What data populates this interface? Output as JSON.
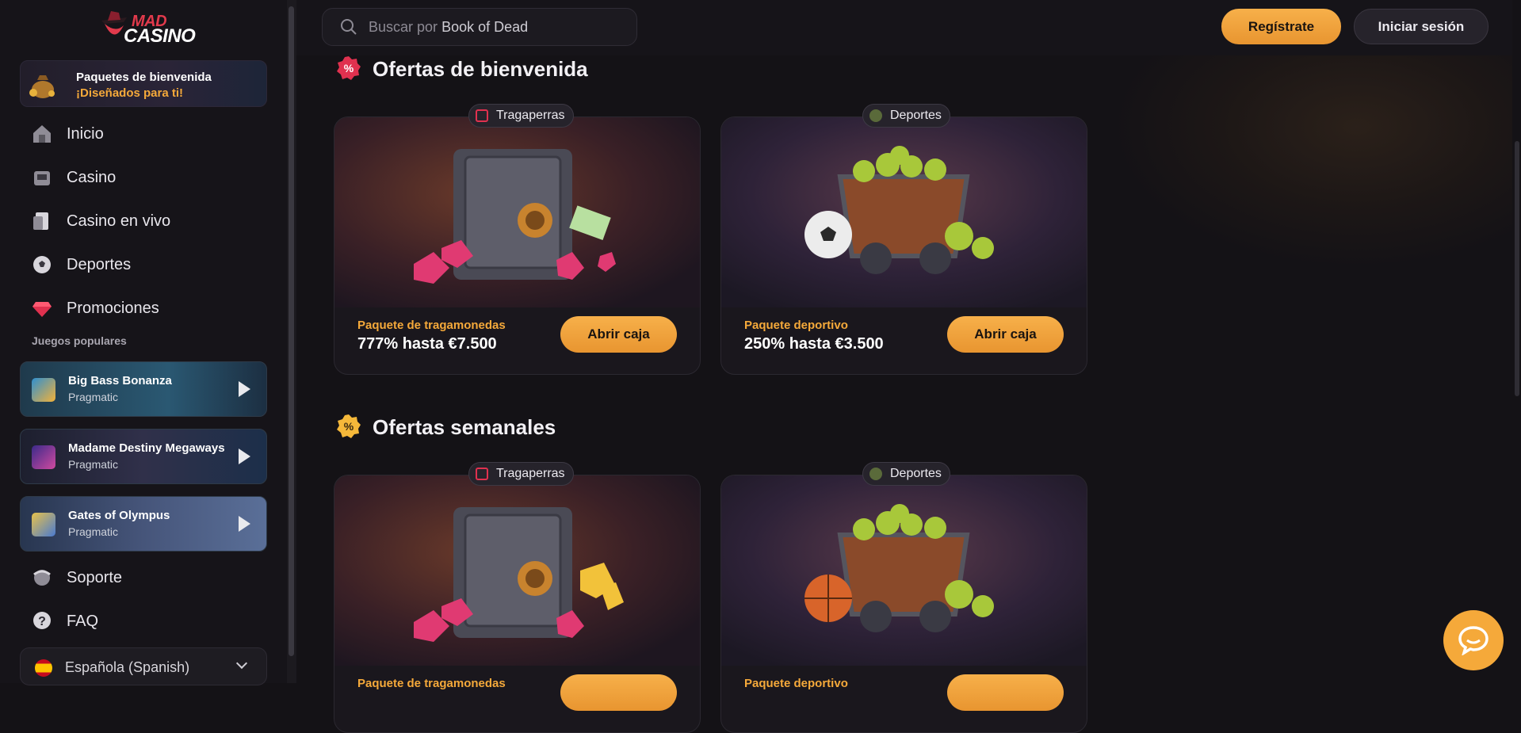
{
  "brand": {
    "logo_top": "MAD",
    "logo_bottom": "CASINO"
  },
  "sidebar": {
    "welcome": {
      "title": "Paquetes de bienvenida",
      "subtitle": "¡Diseñados para ti!"
    },
    "nav": [
      {
        "label": "Inicio",
        "icon": "home-icon"
      },
      {
        "label": "Casino",
        "icon": "casino-icon"
      },
      {
        "label": "Casino en vivo",
        "icon": "live-casino-icon"
      },
      {
        "label": "Deportes",
        "icon": "soccer-ball-icon"
      },
      {
        "label": "Promociones",
        "icon": "diamond-icon"
      }
    ],
    "popular_label": "Juegos populares",
    "games": [
      {
        "name": "Big Bass Bonanza",
        "provider": "Pragmatic"
      },
      {
        "name": "Madame Destiny Megaways",
        "provider": "Pragmatic"
      },
      {
        "name": "Gates of Olympus",
        "provider": "Pragmatic"
      }
    ],
    "bottom_nav": [
      {
        "label": "Soporte",
        "icon": "support-icon"
      },
      {
        "label": "FAQ",
        "icon": "faq-icon"
      }
    ],
    "language": "Española (Spanish)"
  },
  "header": {
    "search_prefix": "Buscar por",
    "search_example": "Book of Dead",
    "register": "Regístrate",
    "login": "Iniciar sesión"
  },
  "sections": [
    {
      "title": "Ofertas de bienvenida",
      "cards": [
        {
          "tag": "Tragaperras",
          "subtitle": "Paquete de tragamonedas",
          "value": "777% hasta €7.500",
          "button": "Abrir caja"
        },
        {
          "tag": "Deportes",
          "subtitle": "Paquete deportivo",
          "value": "250% hasta €3.500",
          "button": "Abrir caja"
        }
      ]
    },
    {
      "title": "Ofertas semanales",
      "cards": [
        {
          "tag": "Tragaperras",
          "subtitle": "Paquete de tragamonedas",
          "value": "",
          "button": ""
        },
        {
          "tag": "Deportes",
          "subtitle": "Paquete deportivo",
          "value": "",
          "button": ""
        }
      ]
    }
  ],
  "colors": {
    "accent": "#f5a93a",
    "background": "#141216",
    "sidebar": "#161419"
  }
}
